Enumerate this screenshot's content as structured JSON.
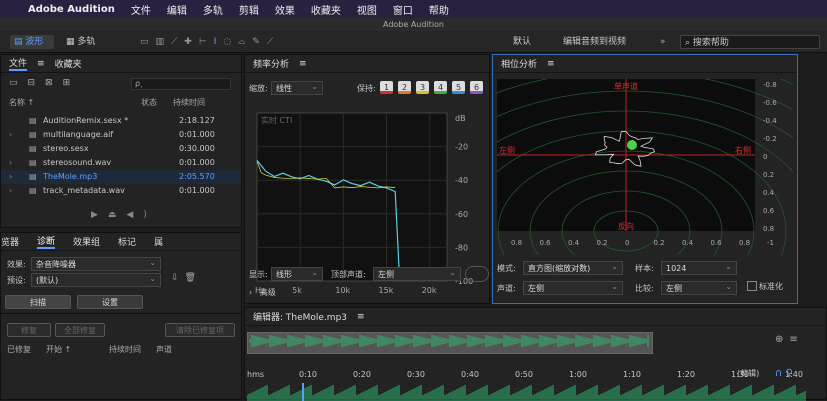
{
  "menubar": {
    "apple": "",
    "app": "Adobe Audition",
    "items": [
      "文件",
      "编辑",
      "多轨",
      "剪辑",
      "效果",
      "收藏夹",
      "视图",
      "窗口",
      "帮助"
    ]
  },
  "window_title": "Adobe Audition",
  "toolbar": {
    "waveform": "波形",
    "multitrack": "多轨",
    "workspace_default": "默认",
    "workspace_edit_video": "编辑音频到视频",
    "search_placeholder": "搜索帮助"
  },
  "files": {
    "tab_files": "文件",
    "tab_favorites": "收藏夹",
    "search_glyph": "ρ˯",
    "col_name": "名称 ↑",
    "col_status": "状态",
    "col_duration": "持续时间",
    "rows": [
      {
        "name": "AuditionRemix.sesx *",
        "dur": "2:18.127"
      },
      {
        "name": "multilanguage.aif",
        "dur": "0:01.000"
      },
      {
        "name": "stereo.sesx",
        "dur": "0:30.000"
      },
      {
        "name": "stereosound.wav",
        "dur": "0:01.000"
      },
      {
        "name": "TheMole.mp3",
        "dur": "2:05.570"
      },
      {
        "name": "track_metadata.wav",
        "dur": "0:01.000"
      }
    ]
  },
  "diag": {
    "tabs": [
      "览器",
      "诊断",
      "效果组",
      "标记",
      "属"
    ],
    "effect_label": "效果:",
    "effect_value": "杂音降噪器",
    "preset_label": "预设:",
    "preset_value": "(默认)",
    "scan": "扫描",
    "settings": "设置",
    "repair": "修复",
    "repair_all": "全部修复",
    "clear_repaired": "清除已修复项",
    "col_repaired": "已修复",
    "col_start": "开始 ↑",
    "col_duration": "持续时间",
    "col_channel": "声道"
  },
  "freq": {
    "title": "频率分析",
    "zoom_label": "缩放:",
    "zoom_value": "线性",
    "hold_label": "保持:",
    "hold_buttons": [
      "1",
      "2",
      "3",
      "4",
      "5",
      "6"
    ],
    "display_label": "显示:",
    "display_value": "线形",
    "channel_label": "顶部声道:",
    "channel_value": "左侧",
    "advanced": "高级",
    "live": "实时 CTI",
    "db_ticks": [
      "dB",
      "-20",
      "-40",
      "-60",
      "-80",
      "-100"
    ],
    "hz_ticks": [
      "Hz",
      "5k",
      "10k",
      "15k",
      "20k"
    ],
    "hold_colors": [
      "#d03030",
      "#e07b20",
      "#d8c020",
      "#40b040",
      "#3090e0",
      "#9050d0"
    ]
  },
  "chart_data": {
    "type": "line",
    "title": "",
    "xlabel": "Hz",
    "ylabel": "dB",
    "xlim": [
      0,
      22000
    ],
    "ylim": [
      -100,
      0
    ],
    "series": [
      {
        "name": "",
        "x": [
          0,
          500,
          1000,
          2000,
          3000,
          4000,
          5000,
          6000,
          7000,
          8000,
          9000,
          10000,
          11000,
          12000,
          13000,
          14000,
          15000,
          16000,
          16500
        ],
        "values": [
          -30,
          -32,
          -34,
          -36,
          -37,
          -38,
          -38,
          -39,
          -40,
          -40,
          -41,
          -41,
          -42,
          -42,
          -43,
          -44,
          -44,
          -45,
          -98
        ]
      }
    ]
  },
  "phase": {
    "title": "相位分析",
    "top": "单声道",
    "bottom": "反向",
    "left": "左侧",
    "right": "右侧",
    "right_ticks": [
      "-0.8",
      "-0.6",
      "-0.4",
      "-0.2",
      "0",
      "0.2",
      "0.4",
      "0.6",
      "0.8"
    ],
    "bottom_ticks": [
      "0.8",
      "0.6",
      "0.4",
      "0.2",
      "0",
      "0.2",
      "0.4",
      "0.6",
      "0.8"
    ],
    "mode_label": "模式:",
    "mode_value": "直方图(缩放对数)",
    "sample_label": "样本:",
    "sample_value": "1024",
    "channel_label": "声道:",
    "channel_value": "左侧",
    "compare_label": "比较:",
    "compare_value": "左侧",
    "normalize": "标准化"
  },
  "editor": {
    "title": "编辑器: TheMole.mp3",
    "ruler_unit": "hms",
    "ruler": [
      "0:10",
      "0:20",
      "0:30",
      "0:40",
      "0:50",
      "1:00",
      "1:10",
      "1:20",
      "1:30",
      "1:40",
      "1:50"
    ],
    "nudge": "(剪辑)"
  }
}
